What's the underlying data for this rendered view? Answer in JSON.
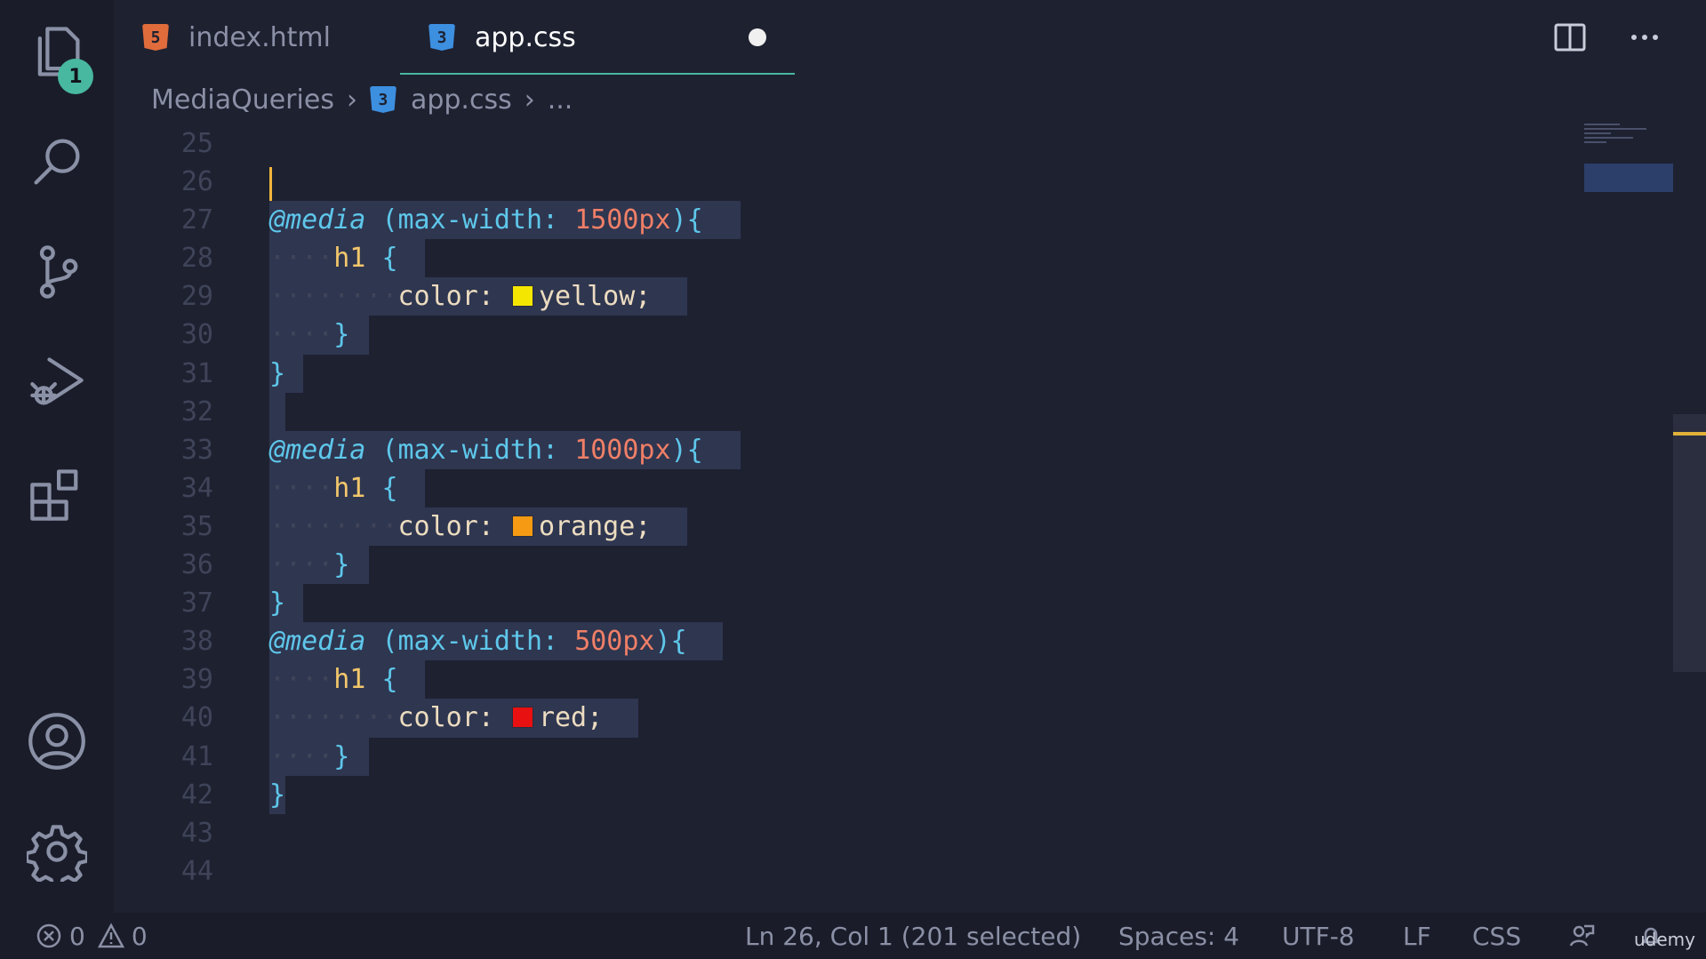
{
  "activity_bar": {
    "explorer_badge": "1",
    "icons": [
      "files-icon",
      "search-icon",
      "source-control-icon",
      "run-debug-icon",
      "extensions-icon",
      "account-icon",
      "gear-icon"
    ]
  },
  "tabs": [
    {
      "label": "index.html",
      "icon": "html5-icon",
      "active": false
    },
    {
      "label": "app.css",
      "icon": "css3-icon",
      "active": true,
      "modified": true
    }
  ],
  "breadcrumb": {
    "folder": "MediaQueries",
    "file": "app.css",
    "more": "..."
  },
  "editor": {
    "line_numbers": [
      "25",
      "26",
      "27",
      "28",
      "29",
      "30",
      "31",
      "32",
      "33",
      "34",
      "35",
      "36",
      "37",
      "38",
      "39",
      "40",
      "41",
      "42",
      "43",
      "44"
    ],
    "blocks": [
      {
        "query_keyword": "@media",
        "query_prop": "(max-width:",
        "query_value": "1500px",
        "query_close": "){",
        "selector": "h1",
        "open": "{",
        "prop": "color:",
        "value": "yellow;",
        "swatch": "#f5e600",
        "close_inner": "}",
        "close_outer": "}"
      },
      {
        "query_keyword": "@media",
        "query_prop": "(max-width:",
        "query_value": "1000px",
        "query_close": "){",
        "selector": "h1",
        "open": "{",
        "prop": "color:",
        "value": "orange;",
        "swatch": "#f59a12",
        "close_inner": "}",
        "close_outer": "}"
      },
      {
        "query_keyword": "@media",
        "query_prop": "(max-width:",
        "query_value": "500px",
        "query_close": "){",
        "selector": "h1",
        "open": "{",
        "prop": "color:",
        "value": "red;",
        "swatch": "#e81010",
        "close_inner": "}",
        "close_outer": "}"
      }
    ]
  },
  "status_bar": {
    "errors": "0",
    "warnings": "0",
    "position": "Ln 26, Col 1 (201 selected)",
    "spaces": "Spaces: 4",
    "encoding": "UTF-8",
    "eol": "LF",
    "language": "CSS",
    "watermark": "udemy"
  },
  "colors": {
    "accent": "#48b8a0",
    "selection": "#2f3650",
    "cursor": "#f2b53c"
  }
}
